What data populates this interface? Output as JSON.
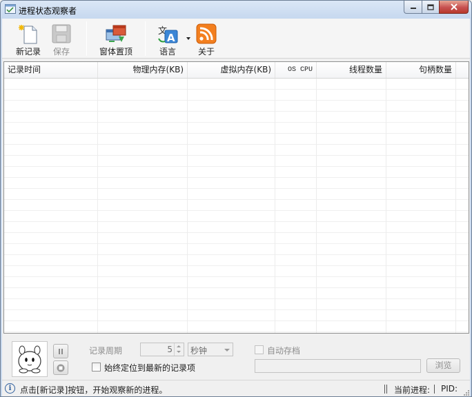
{
  "window": {
    "title": "进程状态观察者",
    "controls": {
      "minimize_icon": "minimize-icon",
      "maximize_icon": "maximize-icon",
      "close_icon": "close-icon"
    }
  },
  "toolbar": {
    "new_record": {
      "label": "新记录",
      "icon": "new-document-icon"
    },
    "save": {
      "label": "保存",
      "icon": "floppy-disk-icon",
      "enabled": false
    },
    "pin_window": {
      "label": "窗体置顶",
      "icon": "pin-window-icon"
    },
    "language": {
      "label": "语言",
      "icon": "language-icon"
    },
    "about": {
      "label": "关于",
      "icon": "rss-icon"
    }
  },
  "grid": {
    "columns": [
      "记录时间",
      "物理内存(KB)",
      "虚拟内存(KB)",
      "OS CPU",
      "线程数量",
      "句柄数量"
    ],
    "rows": []
  },
  "controls": {
    "record_period_label": "记录周期",
    "period_value": "5",
    "period_unit": "秒钟",
    "always_latest_label": "始终定位到最新的记录项",
    "auto_save_label": "自动存档",
    "save_path_value": "",
    "browse_label": "浏览"
  },
  "statusbar": {
    "message": "点击[新记录]按钮，开始观察新的进程。",
    "current_process_label": "当前进程:",
    "pid_label": "PID:"
  },
  "colors": {
    "title_bar": "#c6d8ef",
    "close_button": "#c75050",
    "about_icon": "#f37f1f"
  }
}
